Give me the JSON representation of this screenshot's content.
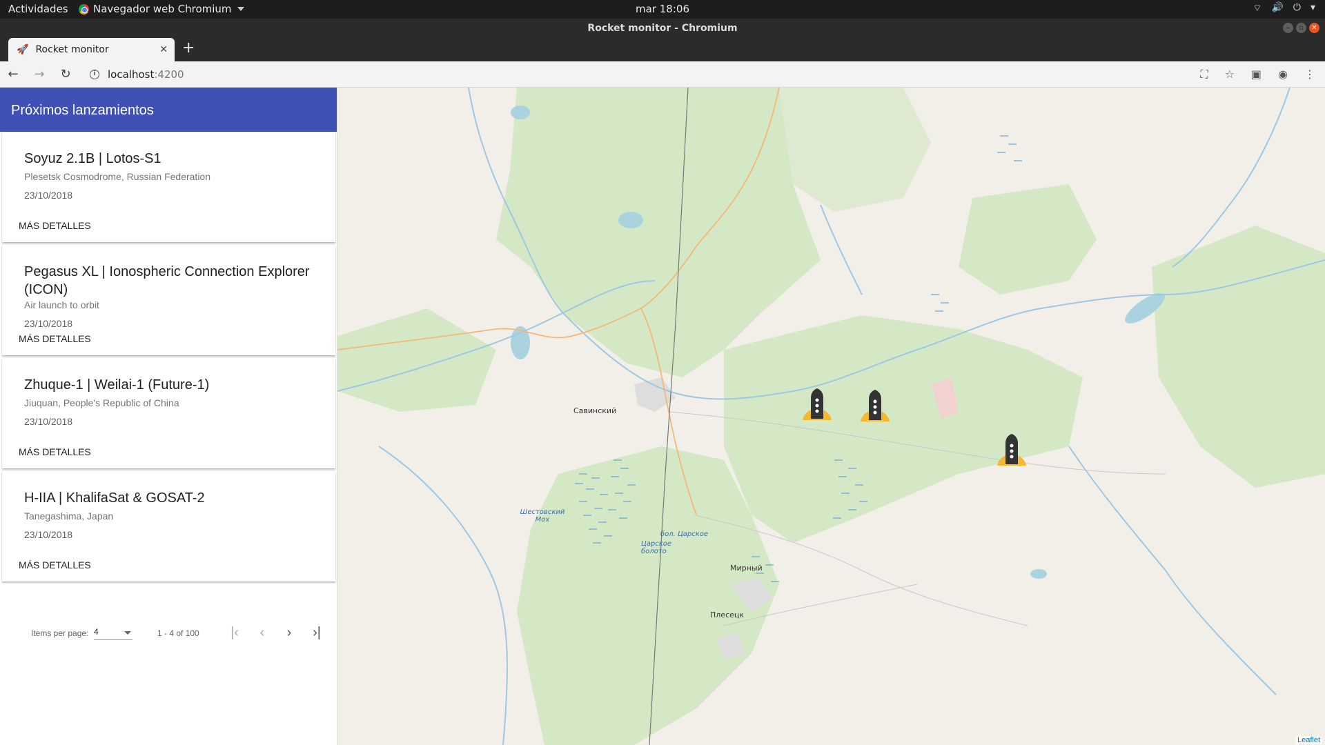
{
  "os": {
    "activities": "Actividades",
    "app_menu": "Navegador web Chromium",
    "clock": "mar 18:06"
  },
  "window": {
    "title": "Rocket monitor - Chromium"
  },
  "tab": {
    "title": "Rocket monitor",
    "favicon": "rocket-icon"
  },
  "address": {
    "host": "localhost",
    "port": ":4200"
  },
  "sidebar": {
    "title": "Próximos lanzamientos",
    "launches": [
      {
        "title": "Soyuz 2.1B | Lotos-S1",
        "location": "Plesetsk Cosmodrome, Russian Federation",
        "date": "23/10/2018",
        "action": "MÁS DETALLES"
      },
      {
        "title": "Pegasus XL | Ionospheric Connection Explorer (ICON)",
        "location": "Air launch to orbit",
        "date": "23/10/2018",
        "action": "MÁS DETALLES"
      },
      {
        "title": "Zhuque-1 | Weilai-1 (Future-1)",
        "location": "Jiuquan, People's Republic of China",
        "date": "23/10/2018",
        "action": "MÁS DETALLES"
      },
      {
        "title": "H-IIA | KhalifaSat & GOSAT-2",
        "location": "Tanegashima, Japan",
        "date": "23/10/2018",
        "action": "MÁS DETALLES"
      }
    ]
  },
  "paginator": {
    "items_label": "Items per page:",
    "page_size": "4",
    "range": "1 - 4 of 100"
  },
  "map": {
    "attribution": "Leaflet",
    "places": {
      "savinsky": "Савинский",
      "mirny": "Мирный",
      "plesetsk": "Плесецк",
      "shestovsky": "Шестовский Мох",
      "tsarskoe": "бол. Царское",
      "tsarskoe_boloto": "Царское болото"
    }
  }
}
